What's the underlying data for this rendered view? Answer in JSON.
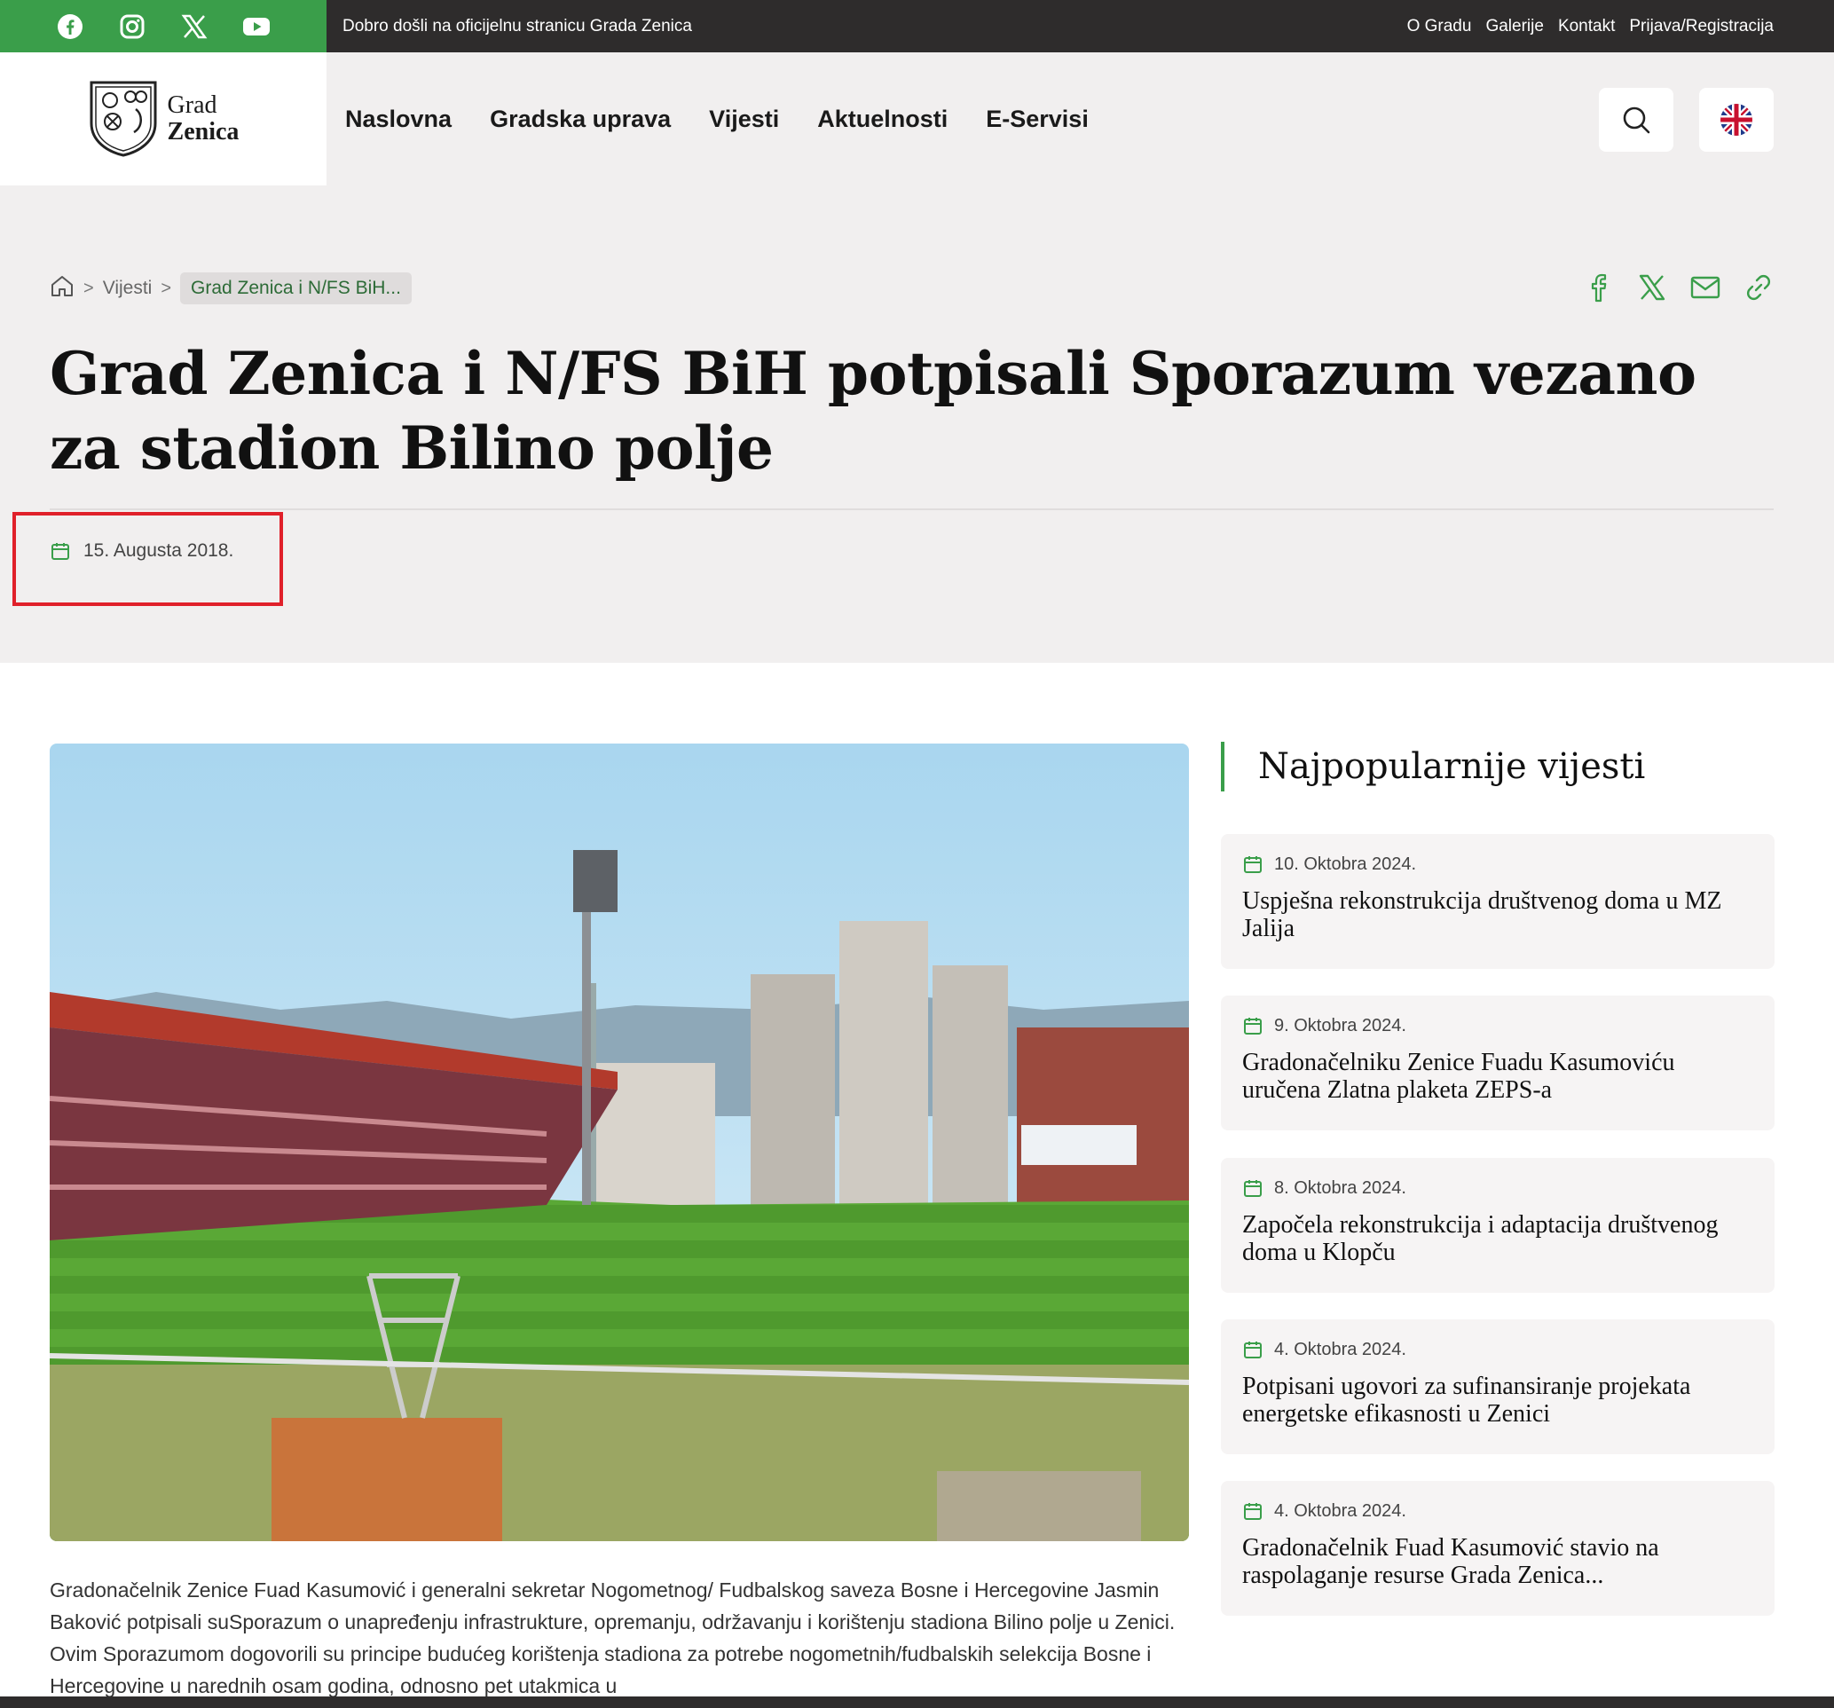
{
  "topbar": {
    "social_icons": [
      "facebook-icon",
      "instagram-icon",
      "x-icon",
      "youtube-icon"
    ],
    "welcome": "Dobro došli na oficijelnu stranicu Grada Zenica",
    "links": [
      "O Gradu",
      "Galerije",
      "Kontakt",
      "Prijava/Registracija"
    ]
  },
  "header": {
    "logo_line1": "Grad",
    "logo_line2": "Zenica",
    "nav": [
      "Naslovna",
      "Gradska uprava",
      "Vijesti",
      "Aktuelnosti",
      "E-Servisi"
    ],
    "search_icon": "search-icon",
    "language_icon": "uk-flag-icon"
  },
  "breadcrumb": {
    "home_icon": "home-icon",
    "items": [
      "Vijesti"
    ],
    "current": "Grad Zenica i N/FS BiH..."
  },
  "share_icons": [
    "facebook-icon",
    "x-icon",
    "mail-icon",
    "link-icon"
  ],
  "article": {
    "title": "Grad Zenica i N/FS BiH potpisali Sporazum vezano za stadion Bilino polje",
    "date": "15. Augusta 2018.",
    "body": "Gradonačelnik Zenice Fuad Kasumović i generalni sekretar Nogometnog/ Fudbalskog saveza Bosne i Hercegovine Jasmin Baković potpisali suSporazum o unapređenju infrastrukture, opremanju, održavanju i korištenju stadiona Bilino polje u Zenici. Ovim Sporazumom dogovorili su principe budućeg korištenja stadiona za potrebe nogometnih/fudbalskih selekcija Bosne i Hercegovine u narednih osam godina, odnosno pet utakmica u"
  },
  "sidebar": {
    "title": "Najpopularnije vijesti",
    "cards": [
      {
        "date": "10. Oktobra 2024.",
        "title": "Uspješna rekonstrukcija društvenog doma u MZ Jalija"
      },
      {
        "date": "9. Oktobra 2024.",
        "title": "Gradonačelniku Zenice Fuadu Kasumoviću uručena Zlatna plaketa ZEPS-a"
      },
      {
        "date": "8. Oktobra 2024.",
        "title": "Započela rekonstrukcija i adaptacija društvenog doma u Klopču"
      },
      {
        "date": "4. Oktobra 2024.",
        "title": "Potpisani ugovori za sufinansiranje projekata energetske efikasnosti u Zenici"
      },
      {
        "date": "4. Oktobra 2024.",
        "title": "Gradonačelnik Fuad Kasumović stavio na raspolaganje resurse Grada Zenica..."
      }
    ]
  },
  "colors": {
    "accent": "#3a9e4a",
    "topbar": "#2e2c2c",
    "hero_bg": "#f1efef",
    "highlight": "#e0202a"
  }
}
